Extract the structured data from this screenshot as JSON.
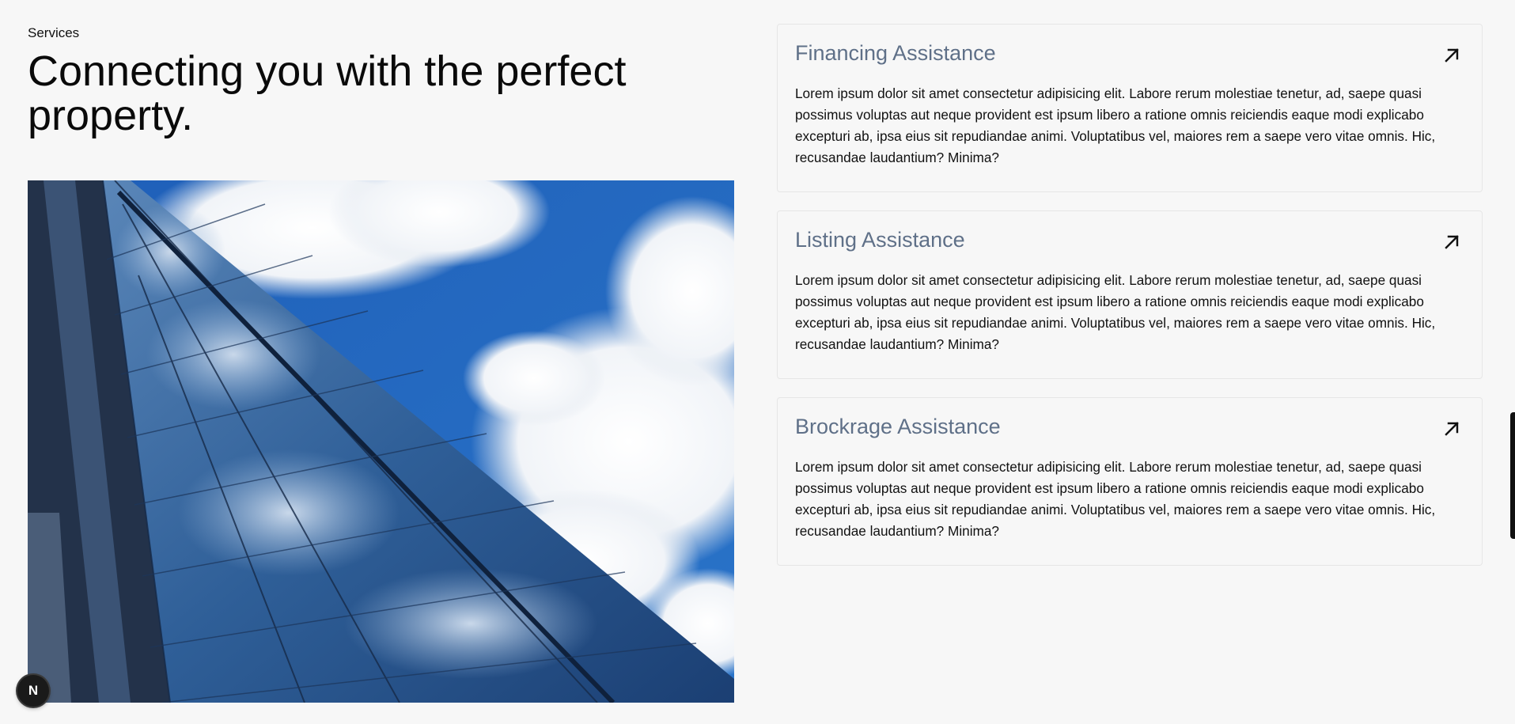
{
  "section": {
    "eyebrow": "Services",
    "headline": "Connecting you with the perfect property."
  },
  "hero_image": {
    "subject": "glass-skyscraper-against-cloudy-sky"
  },
  "services": [
    {
      "title": "Financing Assistance",
      "icon": "arrow-up-right-icon",
      "description": "Lorem ipsum dolor sit amet consectetur adipisicing elit. Labore rerum molestiae tenetur, ad, saepe quasi possimus voluptas aut neque provident est ipsum libero a ratione omnis reiciendis eaque modi explicabo excepturi ab, ipsa eius sit repudiandae animi. Voluptatibus vel, maiores rem a saepe vero vitae omnis. Hic, recusandae laudantium? Minima?"
    },
    {
      "title": "Listing Assistance",
      "icon": "arrow-up-right-icon",
      "description": "Lorem ipsum dolor sit amet consectetur adipisicing elit. Labore rerum molestiae tenetur, ad, saepe quasi possimus voluptas aut neque provident est ipsum libero a ratione omnis reiciendis eaque modi explicabo excepturi ab, ipsa eius sit repudiandae animi. Voluptatibus vel, maiores rem a saepe vero vitae omnis. Hic, recusandae laudantium? Minima?"
    },
    {
      "title": "Brockrage Assistance",
      "icon": "arrow-up-right-icon",
      "description": "Lorem ipsum dolor sit amet consectetur adipisicing elit. Labore rerum molestiae tenetur, ad, saepe quasi possimus voluptas aut neque provident est ipsum libero a ratione omnis reiciendis eaque modi explicabo excepturi ab, ipsa eius sit repudiandae animi. Voluptatibus vel, maiores rem a saepe vero vitae omnis. Hic, recusandae laudantium? Minima?"
    }
  ],
  "dev_badge": {
    "label": "N"
  },
  "colors": {
    "background": "#f7f7f7",
    "card_title": "#5f7088",
    "text": "#111111"
  }
}
